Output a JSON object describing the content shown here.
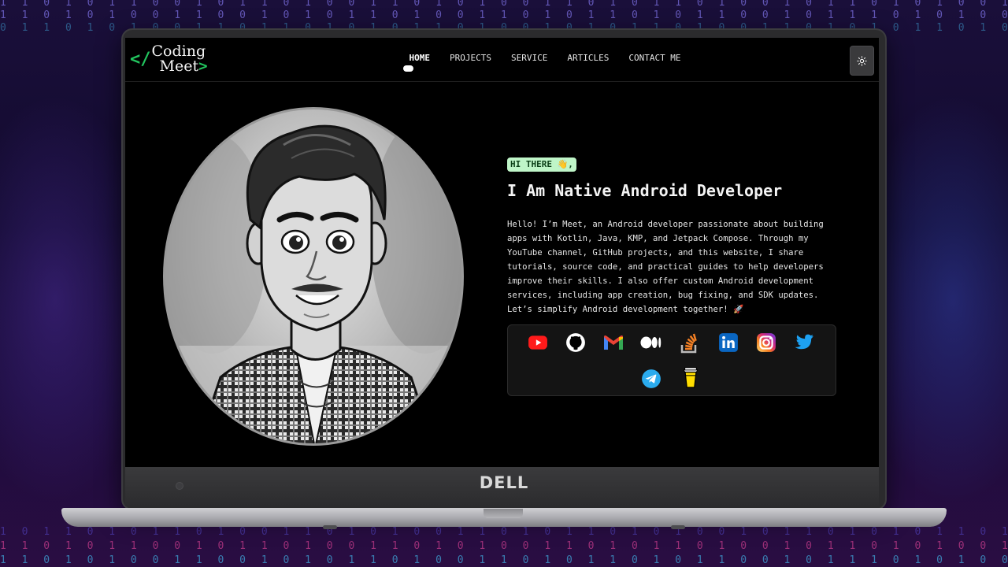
{
  "background": {
    "binary_rows": [
      "1 1 0 1 0 1 1 0 0 1 0 1 1 0 1 0 0 1 1 0 1 0 1 0 0 1 1 0 1 0 1 1 0 1 0 0 1 0 1 1 0 1 0 1 0 0 1 1 0 1 0 0 1 0 1 1 0 1 0 1 0 0 1 0 1 0 1 1 0 1 0 1 0 0",
      "1 1 0 1 0 1 0 0 1 1 0 0 1 0 1 0 1 1 0 1 0 0 1 1 0 1 0 1 1 0 1 0 1 1 0 0 1 0 1 1 1 0 1 0 1 0 0 1 1 0 1 0 1 1 0 1 0 0 1 0 1 0 1 0 1 1 0 1 0 1 0 0",
      "0 1 1 0 1 0 1 0 0 1 1 0 1 1 0 1 0 1 0 1 1 0 1 0 0 1 0 1 0 1 1 0 1 0 0 1 1 0 1 0 1 0 1 1 0 1 0 0 1 0 1 1 0 1 0 1 0 0 1 1 0 1 0 1 0 1 1 0 1 0 1 1",
      "1 0 1 1 0 1 0 1 1 0 1 0 0 1 1 0 1 0 1 0 0 1 1 0 1 0 1 1 0 1 0 1 0 0 1 0 1 1 0 1 0 1 0 1 1 0 1 0 0 1 1 0 1 0 1 0 1 0 0 1 1 0 1 0 1 0 1 1 0 1 0 0"
    ],
    "colors": {
      "top": "#7b6fe0",
      "mid": "#4a3aa8",
      "cyan": "#3fa4d8",
      "pink": "#c23b8a"
    }
  },
  "device": {
    "brand": "DELL"
  },
  "site": {
    "logo": {
      "bracket_open": "</",
      "line1": "Coding",
      "line2": "Meet",
      "bracket_close": ">",
      "accent": "#22c55e"
    },
    "nav": [
      {
        "label": "HOME",
        "active": true
      },
      {
        "label": "PROJECTS",
        "active": false
      },
      {
        "label": "SERVICE",
        "active": false
      },
      {
        "label": "ARTICLES",
        "active": false
      },
      {
        "label": "CONTACT ME",
        "active": false
      }
    ],
    "theme_toggle_icon": "sun-icon"
  },
  "hero": {
    "badge": "HI THERE 👋,",
    "title": "I Am Native Android Developer",
    "description": "Hello! I’m Meet, an Android developer passionate about building apps with Kotlin, Java, KMP, and Jetpack Compose. Through my YouTube channel, GitHub projects, and this website, I share tutorials, source code, and practical guides to help developers improve their skills. I also offer custom Android development services, including app creation, bug fixing, and SDK updates. Let’s simplify Android development together! 🚀",
    "avatar_icon": "cartoon-avatar-portrait"
  },
  "socials": [
    {
      "name": "youtube-icon",
      "color": "#ff0000"
    },
    {
      "name": "github-icon",
      "color": "#ffffff"
    },
    {
      "name": "gmail-icon",
      "color": "#ea4335"
    },
    {
      "name": "medium-icon",
      "color": "#ffffff"
    },
    {
      "name": "stackoverflow-icon",
      "color": "#f48024"
    },
    {
      "name": "linkedin-icon",
      "color": "#0a66c2"
    },
    {
      "name": "instagram-icon",
      "color": "#e1306c"
    },
    {
      "name": "twitter-icon",
      "color": "#1da1f2"
    },
    {
      "name": "telegram-icon",
      "color": "#2aabee"
    },
    {
      "name": "buymeacoffee-icon",
      "color": "#ffdd00"
    }
  ]
}
